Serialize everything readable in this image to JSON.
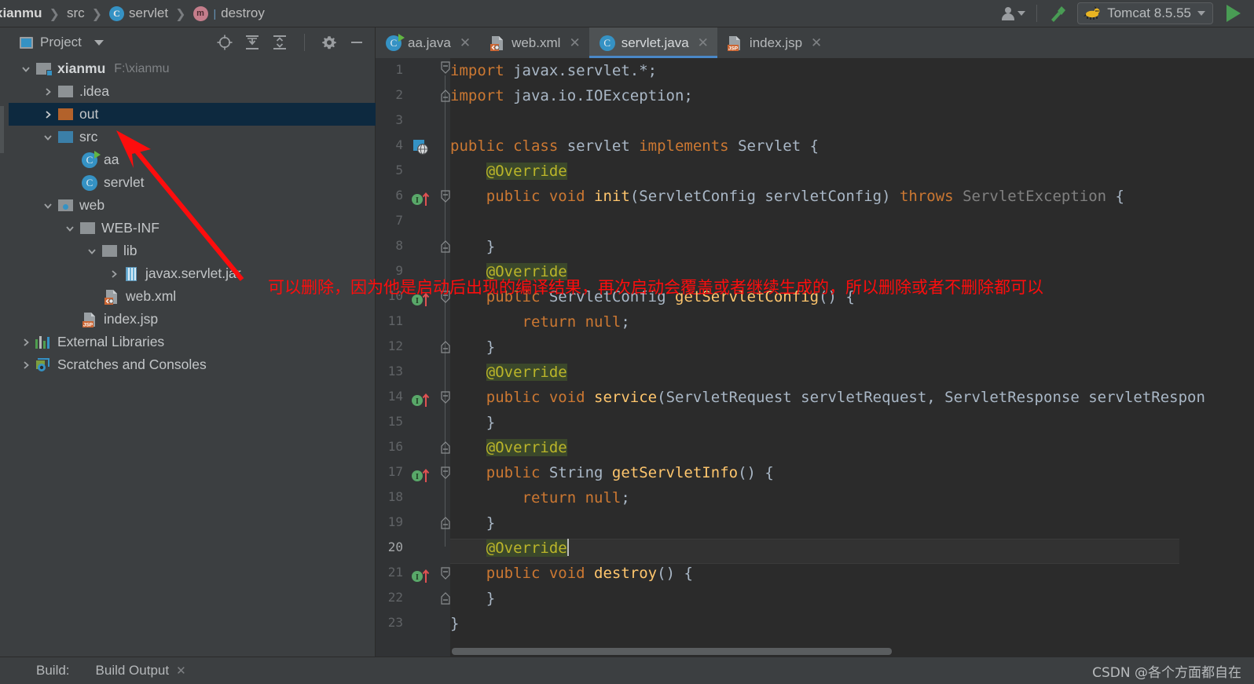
{
  "window": {
    "breadcrumb": [
      {
        "label": "xianmu",
        "icon": "none"
      },
      {
        "label": "src",
        "icon": "none"
      },
      {
        "label": "servlet",
        "icon": "class-icon"
      },
      {
        "label": "destroy",
        "icon": "method-icon"
      }
    ],
    "toolbar": {
      "user_icon": "person-icon",
      "build_icon": "hammer-icon",
      "run_config": "Tomcat 8.5.55",
      "run_config_icon": "tomcat-icon",
      "run_icon": "run-triangle-icon",
      "dropdown_icon": "chevron-down-icon"
    }
  },
  "project_panel": {
    "title": "Project",
    "title_icon": "project-window-icon",
    "dropdown_icon": "chevron-down-icon",
    "tools": [
      {
        "name": "locate-icon",
        "glyph": "target"
      },
      {
        "name": "expand-all-icon",
        "glyph": "expand"
      },
      {
        "name": "collapse-all-icon",
        "glyph": "collapse"
      },
      {
        "name": "settings-gear-icon",
        "glyph": "gear"
      },
      {
        "name": "hide-panel-icon",
        "glyph": "minus"
      }
    ],
    "tree": [
      {
        "label": "xianmu",
        "suffix": "F:\\xianmu",
        "indent": 0,
        "arrow": "down",
        "icon": "module-folder-icon",
        "bold": true,
        "selected": false
      },
      {
        "label": ".idea",
        "suffix": "",
        "indent": 1,
        "arrow": "right",
        "icon": "folder-grey-icon",
        "bold": false,
        "selected": false
      },
      {
        "label": "out",
        "suffix": "",
        "indent": 1,
        "arrow": "right",
        "icon": "folder-orange-icon",
        "bold": false,
        "selected": true
      },
      {
        "label": "src",
        "suffix": "",
        "indent": 1,
        "arrow": "down",
        "icon": "folder-source-icon",
        "bold": false,
        "selected": false
      },
      {
        "label": "aa",
        "suffix": "",
        "indent": 2,
        "arrow": "none",
        "icon": "java-class-runnable-icon",
        "bold": false,
        "selected": false
      },
      {
        "label": "servlet",
        "suffix": "",
        "indent": 2,
        "arrow": "none",
        "icon": "java-class-icon",
        "bold": false,
        "selected": false
      },
      {
        "label": "web",
        "suffix": "",
        "indent": 1,
        "arrow": "down",
        "icon": "web-folder-icon",
        "bold": false,
        "selected": false
      },
      {
        "label": "WEB-INF",
        "suffix": "",
        "indent": 2,
        "arrow": "down",
        "icon": "folder-grey-icon",
        "bold": false,
        "selected": false
      },
      {
        "label": "lib",
        "suffix": "",
        "indent": 3,
        "arrow": "down",
        "icon": "folder-grey-icon",
        "bold": false,
        "selected": false
      },
      {
        "label": "javax.servlet.jar",
        "suffix": "",
        "indent": 4,
        "arrow": "right",
        "icon": "jar-icon",
        "bold": false,
        "selected": false
      },
      {
        "label": "web.xml",
        "suffix": "",
        "indent": 3,
        "arrow": "none",
        "icon": "xml-file-icon",
        "bold": false,
        "selected": false
      },
      {
        "label": "index.jsp",
        "suffix": "",
        "indent": 2,
        "arrow": "none",
        "icon": "jsp-file-icon",
        "bold": false,
        "selected": false
      },
      {
        "label": "External Libraries",
        "suffix": "",
        "indent": 0,
        "arrow": "right",
        "icon": "libraries-icon",
        "bold": false,
        "selected": false
      },
      {
        "label": "Scratches and Consoles",
        "suffix": "",
        "indent": 0,
        "arrow": "right",
        "icon": "scratches-icon",
        "bold": false,
        "selected": false
      }
    ]
  },
  "editor": {
    "tabs": [
      {
        "label": "aa.java",
        "icon": "java-class-runnable-icon",
        "active": false,
        "close_icon": "close-icon"
      },
      {
        "label": "web.xml",
        "icon": "xml-file-icon",
        "active": false,
        "close_icon": "close-icon"
      },
      {
        "label": "servlet.java",
        "icon": "java-class-icon",
        "active": true,
        "close_icon": "close-icon"
      },
      {
        "label": "index.jsp",
        "icon": "jsp-file-icon",
        "active": false,
        "close_icon": "close-icon"
      }
    ],
    "cursor_line": 20,
    "lines": [
      {
        "n": 1,
        "text": "import javax.servlet.*;",
        "fold": "fold-start",
        "gutter": "none"
      },
      {
        "n": 2,
        "text": "import java.io.IOException;",
        "fold": "fold-end",
        "gutter": "none"
      },
      {
        "n": 3,
        "text": "",
        "fold": "none",
        "gutter": "none"
      },
      {
        "n": 4,
        "text": "public class servlet implements Servlet {",
        "fold": "none",
        "gutter": "servlet-marker-icon"
      },
      {
        "n": 5,
        "text": "    @Override",
        "fold": "none",
        "gutter": "none"
      },
      {
        "n": 6,
        "text": "    public void init(ServletConfig servletConfig) throws ServletException {",
        "fold": "fold-start",
        "gutter": "implements-method-icon"
      },
      {
        "n": 7,
        "text": "",
        "fold": "none",
        "gutter": "none"
      },
      {
        "n": 8,
        "text": "    }",
        "fold": "fold-end",
        "gutter": "none"
      },
      {
        "n": 9,
        "text": "    @Override",
        "fold": "none",
        "gutter": "none"
      },
      {
        "n": 10,
        "text": "    public ServletConfig getServletConfig() {",
        "fold": "fold-start",
        "gutter": "implements-method-icon"
      },
      {
        "n": 11,
        "text": "        return null;",
        "fold": "none",
        "gutter": "none"
      },
      {
        "n": 12,
        "text": "    }",
        "fold": "fold-end",
        "gutter": "none"
      },
      {
        "n": 13,
        "text": "    @Override",
        "fold": "none",
        "gutter": "none"
      },
      {
        "n": 14,
        "text": "    public void service(ServletRequest servletRequest, ServletResponse servletRespon",
        "fold": "fold-start",
        "gutter": "implements-method-icon"
      },
      {
        "n": 15,
        "text": "    }",
        "fold": "fold-end",
        "gutter": "none"
      },
      {
        "n": 16,
        "text": "    @Override",
        "fold": "none",
        "gutter": "none"
      },
      {
        "n": 17,
        "text": "    public String getServletInfo() {",
        "fold": "fold-start",
        "gutter": "implements-method-icon"
      },
      {
        "n": 18,
        "text": "        return null;",
        "fold": "none",
        "gutter": "none"
      },
      {
        "n": 19,
        "text": "    }",
        "fold": "fold-end",
        "gutter": "none"
      },
      {
        "n": 20,
        "text": "    @Override",
        "fold": "none",
        "gutter": "none"
      },
      {
        "n": 21,
        "text": "    public void destroy() {",
        "fold": "fold-start",
        "gutter": "implements-method-icon"
      },
      {
        "n": 22,
        "text": "    }",
        "fold": "fold-end",
        "gutter": "none"
      },
      {
        "n": 23,
        "text": "}",
        "fold": "none",
        "gutter": "none"
      }
    ]
  },
  "annotation": {
    "text": "可以删除，因为他是启动后出现的编译结果，再次启动会覆盖或者继续生成的，所以删除或者不删除都可以",
    "color": "#fd0d0d",
    "arrow": "red-arrow-pointer"
  },
  "status_bar": {
    "build_label": "Build:",
    "build_output_tab": "Build Output",
    "close_icon": "close-icon"
  },
  "watermark": {
    "text": "CSDN @各个方面都自在"
  },
  "colors": {
    "panel_bg": "#3c3f41",
    "editor_bg": "#2b2b2b",
    "gutter_bg": "#313335",
    "selection": "#0d293f",
    "accent_blue": "#4a88c7",
    "keyword_orange": "#cc7832",
    "method_yellow": "#ffc66d",
    "annotation_olive": "#bbb529",
    "run_green": "#499c54",
    "red_markup": "#fd0d0d"
  }
}
